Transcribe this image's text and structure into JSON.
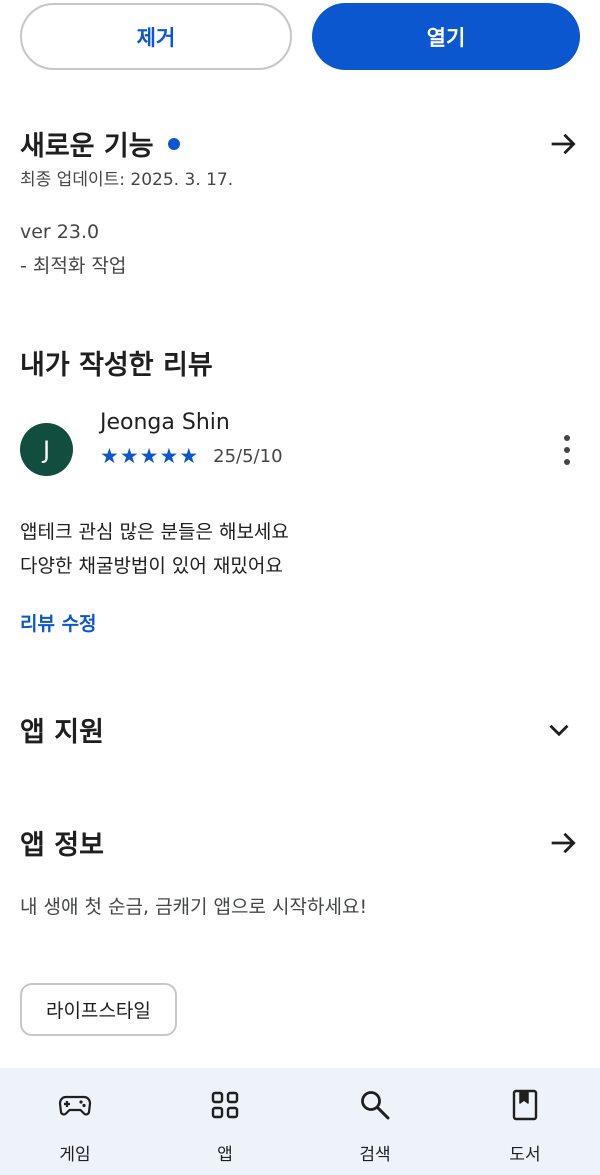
{
  "actions": {
    "remove_label": "제거",
    "open_label": "열기"
  },
  "whats_new": {
    "title": "새로운 기능",
    "last_updated": "최종 업데이트: 2025. 3. 17.",
    "version": "ver 23.0",
    "notes": "- 최적화 작업"
  },
  "my_review": {
    "title": "내가 작성한 리뷰",
    "avatar_initial": "J",
    "reviewer_name": "Jeonga Shin",
    "rating": 5,
    "date": "25/5/10",
    "text_line1": "앱테크 관심 많은 분들은 해보세요",
    "text_line2": "다양한 채굴방법이 있어 재밌어요",
    "edit_label": "리뷰 수정"
  },
  "app_support": {
    "title": "앱 지원"
  },
  "app_info": {
    "title": "앱 정보",
    "description": "내 생애 첫 순금, 금캐기 앱으로 시작하세요!",
    "category_chip": "라이프스타일"
  },
  "bottom_nav": {
    "items": [
      {
        "label": "게임",
        "icon": "gamepad-icon"
      },
      {
        "label": "앱",
        "icon": "apps-grid-icon"
      },
      {
        "label": "검색",
        "icon": "search-icon"
      },
      {
        "label": "도서",
        "icon": "book-icon"
      }
    ]
  },
  "colors": {
    "accent": "#0b57d0",
    "avatar_bg": "#124e3f",
    "nav_bg": "#eef2f9"
  }
}
